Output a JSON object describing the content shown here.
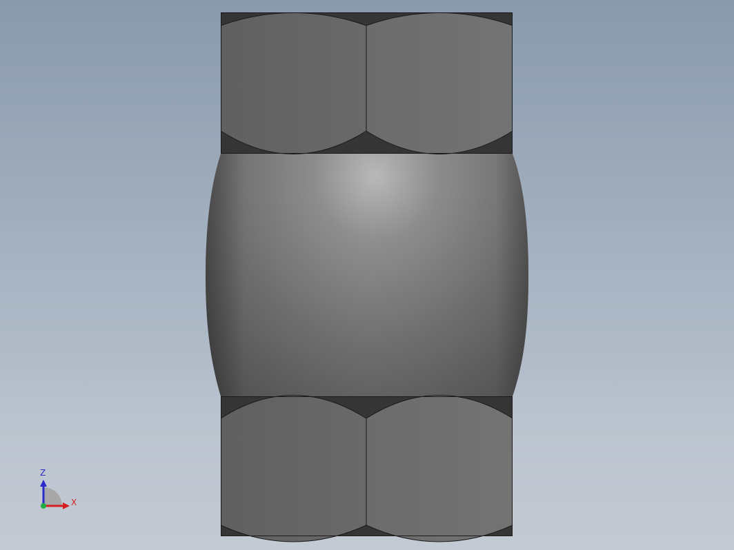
{
  "view": {
    "background_top": "#8a9aac",
    "background_bottom": "#c3cad4"
  },
  "model": {
    "part_color": "#6a6a6a",
    "body_highlight": "#b8b8b8",
    "edge_color": "#1a1a1a",
    "components": [
      "top-hex-nut",
      "spherical-body",
      "bottom-hex-nut"
    ]
  },
  "triad": {
    "z_label": "Z",
    "x_label": "X",
    "z_color": "#2b2bcc",
    "x_color": "#d42020",
    "origin_color": "#22aa44"
  }
}
